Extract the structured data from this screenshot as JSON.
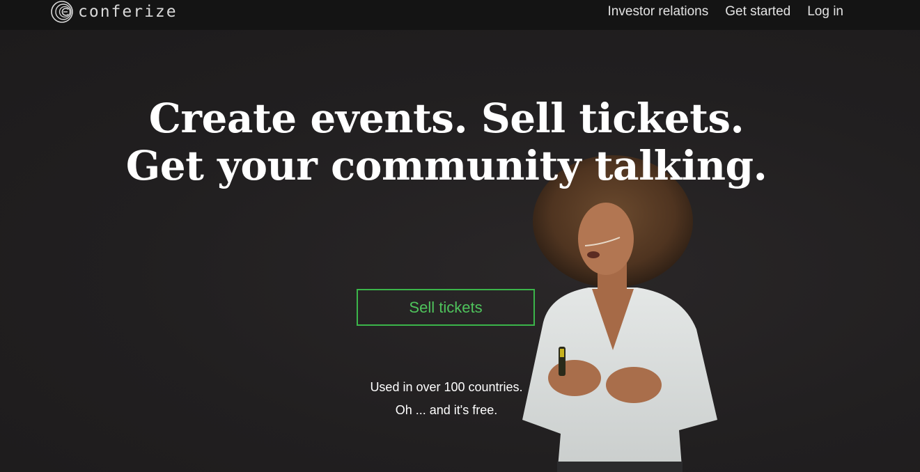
{
  "brand": {
    "name": "conferize"
  },
  "nav": {
    "items": [
      {
        "label": "Investor relations"
      },
      {
        "label": "Get started"
      },
      {
        "label": "Log in"
      }
    ]
  },
  "hero": {
    "headline_line1": "Create events. Sell tickets.",
    "headline_line2": "Get your community talking.",
    "cta_label": "Sell tickets",
    "tagline_line1": "Used in over 100 countries.",
    "tagline_line2": "Oh ... and it's free."
  },
  "colors": {
    "background": "#211f20",
    "topbar": "#141414",
    "accent": "#3bb54a",
    "text": "#ffffff"
  },
  "icons": {
    "logo": "conferize-logo-icon"
  }
}
